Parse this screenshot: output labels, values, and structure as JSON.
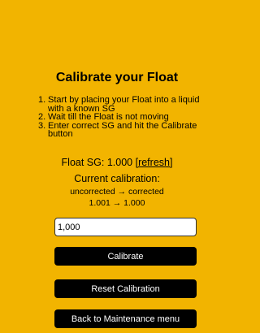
{
  "page": {
    "title": "Calibrate your Float",
    "steps": [
      {
        "num": "1.",
        "text": "Start by placing your Float into a liquid with a known SG"
      },
      {
        "num": "2.",
        "text": "Wait till the Float is not moving"
      },
      {
        "num": "3.",
        "text": "Enter correct SG and hit the Calibrate button"
      }
    ],
    "float_sg_label": "Float SG: 1.000",
    "refresh_link": "[refresh]",
    "calibration_heading": "Current calibration:",
    "calibration_sub": "uncorrected → corrected",
    "calibration_values": "1.001 → 1.000"
  },
  "form": {
    "sg_value": "1,000"
  },
  "buttons": {
    "calibrate": "Calibrate",
    "reset": "Reset Calibration",
    "back": "Back to Maintenance menu"
  },
  "colors": {
    "background": "#f2b400",
    "button": "#000000",
    "button_text": "#ffffff"
  }
}
